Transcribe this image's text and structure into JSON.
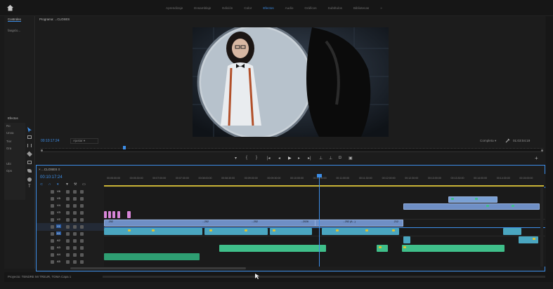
{
  "topbar": {
    "workspaces": [
      "Aprendizaje",
      "Ensamblaje",
      "Edición",
      "Color",
      "Efectos",
      "Audio",
      "Gráficos",
      "Subtítulos",
      "Bibliotecas"
    ],
    "active_workspace": "Efectos",
    "more_label": "»"
  },
  "left_panel": {
    "tab_label": "Controles",
    "subitem": "fangs/o...",
    "lower_label": "Efectos",
    "items": [
      "Ro",
      "Unna",
      "Tier",
      "Gra",
      "Ubi",
      "Ops"
    ]
  },
  "program": {
    "tab_label": "Programa: ...CLOSES",
    "timecode": "00:10:17:24",
    "fit_label": "Ajustar",
    "quality_label": "Completa",
    "duration": "01:03:04:19"
  },
  "timeline": {
    "tab_label": "...CLOSES",
    "timecode": "00:10:17:24",
    "ruler_ticks": [
      "00:05:00:00",
      "00:05:30:00",
      "00:07:00:00",
      "00:07:30:00",
      "00:08:00:00",
      "00:08:30:00",
      "00:09:00:00",
      "00:09:30:00",
      "00:10:00:00",
      "00:10:30:00",
      "00:11:00:00",
      "00:11:30:00",
      "00:12:00:00",
      "00:12:30:00",
      "00:13:00:00",
      "00:13:30:00",
      "00:14:00:00",
      "00:14:30:00",
      "00:15:00:00"
    ],
    "video_tracks": [
      "V6",
      "V5",
      "V4",
      "V3",
      "V2",
      "V1"
    ],
    "audio_tracks": [
      "A1",
      "A2",
      "A3",
      "A4",
      "A5"
    ],
    "clip_labels": [
      ".252",
      "...252",
      "...252",
      "...2026",
      "...252 (A...)",
      ".212"
    ]
  },
  "status": {
    "project_label": "Proyecto: TENDRE MI TREUR, TOMA Capa 1"
  },
  "colors": {
    "accent": "#3d8ee8",
    "video_clip": "#6f8fc5",
    "audio_clip": "#4aa6c0",
    "green_clip": "#3fbf8a",
    "pink_clip": "#d785d8"
  }
}
